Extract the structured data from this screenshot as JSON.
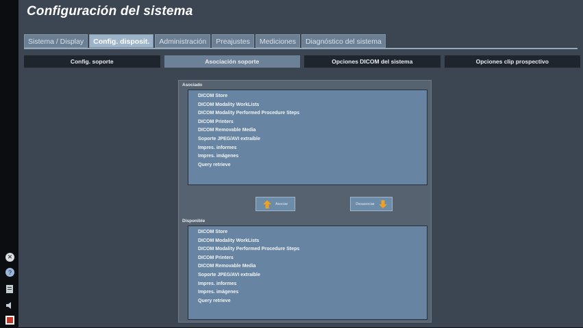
{
  "page": {
    "title": "Configuración del sistema"
  },
  "tabs": [
    {
      "label": "Sistema / Display",
      "active": false
    },
    {
      "label": "Config. disposit.",
      "active": true
    },
    {
      "label": "Administración",
      "active": false
    },
    {
      "label": "Preajustes",
      "active": false
    },
    {
      "label": "Mediciones",
      "active": false
    },
    {
      "label": "Diagnóstico del sistema",
      "active": false
    }
  ],
  "subtabs": [
    {
      "label": "Config. soporte",
      "active": false
    },
    {
      "label": "Asociación soporte",
      "active": true
    },
    {
      "label": "Opciones DICOM del sistema",
      "active": false
    },
    {
      "label": "Opciones clip prospectivo",
      "active": false
    }
  ],
  "associated": {
    "label": "Asociado",
    "items": [
      "DICOM Store",
      "DICOM Modality WorkLists",
      "DICOM Modality Performed Procedure Steps",
      "DICOM Printers",
      "DICOM Removable Media",
      "Soporte JPEG/AVI extraíble",
      "Impres. informes",
      "Impres. imágenes",
      "Query retrieve"
    ]
  },
  "buttons": {
    "associate": "Asociar",
    "disassociate": "Desasociar"
  },
  "available": {
    "label": "Disponible",
    "items": [
      "DICOM Store",
      "DICOM Modality WorkLists",
      "DICOM Modality Performed Procedure Steps",
      "DICOM Printers",
      "DICOM Removable Media",
      "Soporte JPEG/AVI extraíble",
      "Impres. informes",
      "Impres. imágenes",
      "Query retrieve"
    ]
  },
  "sidebar_icons": [
    "close-circle-icon",
    "help-circle-icon",
    "document-icon",
    "speaker-icon",
    "app-icon"
  ],
  "colors": {
    "background": "#3b4652",
    "tab_active": "#9db4c8",
    "listbox": "#6785a2",
    "arrow": "#f0a020"
  }
}
